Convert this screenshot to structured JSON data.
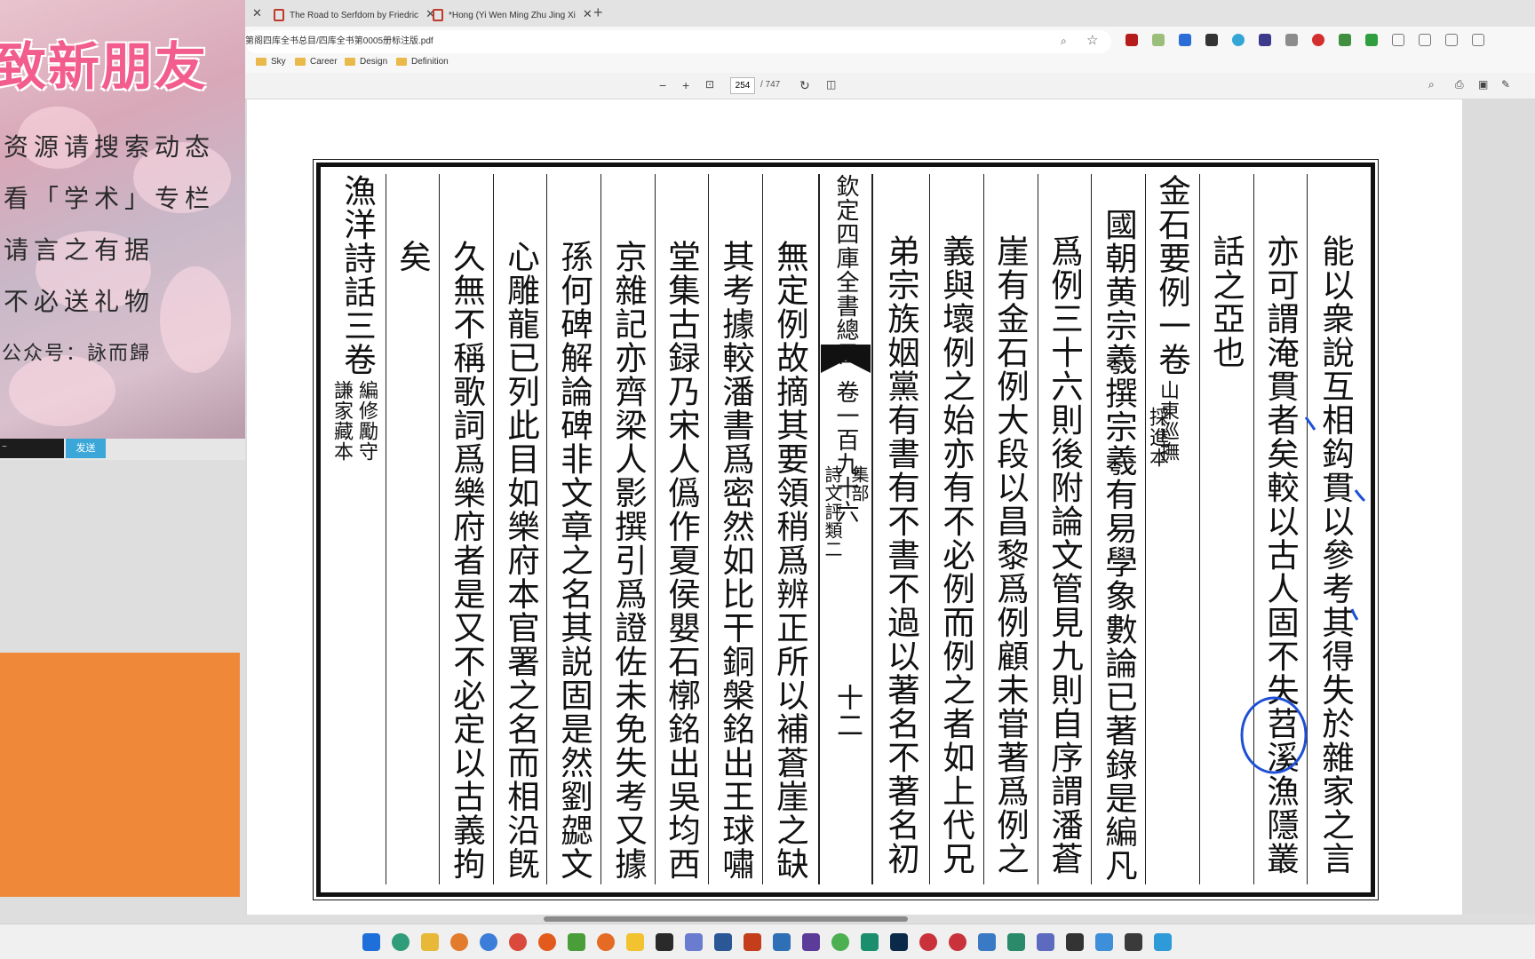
{
  "left_panel": {
    "title": "致新朋友",
    "lines": [
      "资源请搜索动态",
      "看「学术」专栏",
      "请言之有据",
      "不必送礼物"
    ],
    "footer": "公众号：詠而歸",
    "chat_input": "~",
    "send_label": "发送"
  },
  "browser": {
    "tabs": [
      {
        "label": "The Road to Serfdom by Friedric"
      },
      {
        "label": "*Hong (Yi Wen Ming Zhu Jing Xi"
      }
    ],
    "url": "第阁四库全书总目/四库全书第0005册标注版.pdf",
    "bookmarks": [
      "Sky",
      "Career",
      "Design",
      "Definition"
    ]
  },
  "pdf": {
    "page_number": "254",
    "page_total": "/ 747"
  },
  "document": {
    "columns": [
      {
        "text": "能以衆說互相鈎貫以參考其得失於雜家之言"
      },
      {
        "text": "亦可謂淹貫者矣較以古人固不失苕溪漁隱叢"
      },
      {
        "text": "話之亞也"
      },
      {
        "text": "金石要例一卷"
      },
      {
        "text": "國朝黄宗羲撰宗羲有易學象數論已著錄是編凡"
      },
      {
        "text": "爲例三十六則後附論文管見九則自序謂潘蒼"
      },
      {
        "text": "崖有金石例大段以昌黎爲例顧未甞著爲例之"
      },
      {
        "text": "義與壞例之始亦有不必例而例之者如上代兄"
      },
      {
        "text": "弟宗族姻黨有書有不書不過以著名不著名初"
      },
      {
        "text": "無定例故摘其要領稍爲辨正所以補蒼崖之缺"
      },
      {
        "text": "其考據較潘書爲密然如比干銅槃銘出王球嘯"
      },
      {
        "text": "堂集古録乃宋人僞作夏侯嬰石槨銘出吳均西"
      },
      {
        "text": "京雜記亦齊梁人影撰引爲證佐未免失考又據"
      },
      {
        "text": "孫何碑解論碑非文章之名其説固是然劉勰文"
      },
      {
        "text": "心雕龍已列此目如樂府本官署之名而相沿旣"
      },
      {
        "text": "久無不稱歌詞爲樂府者是又不必定以古義拘"
      },
      {
        "text": "矣"
      },
      {
        "text": "漁洋詩話三卷"
      }
    ],
    "notes": {
      "jinshi_source": "山東巡撫",
      "jinshi_source2": "採進本",
      "yuyang_source": "編修勵守",
      "yuyang_source2": "謙家藏本"
    },
    "center_column": {
      "top": "欽定四庫全書總目",
      "volume": "卷一百九十六",
      "section": "集部",
      "subsection": "詩文評類二",
      "page": "十二"
    }
  },
  "colors": {
    "accent_pink": "#f25d8e",
    "orange_block": "#f0883a",
    "send_button": "#3aa7d8",
    "ink_annotation": "#1f4fd6"
  }
}
